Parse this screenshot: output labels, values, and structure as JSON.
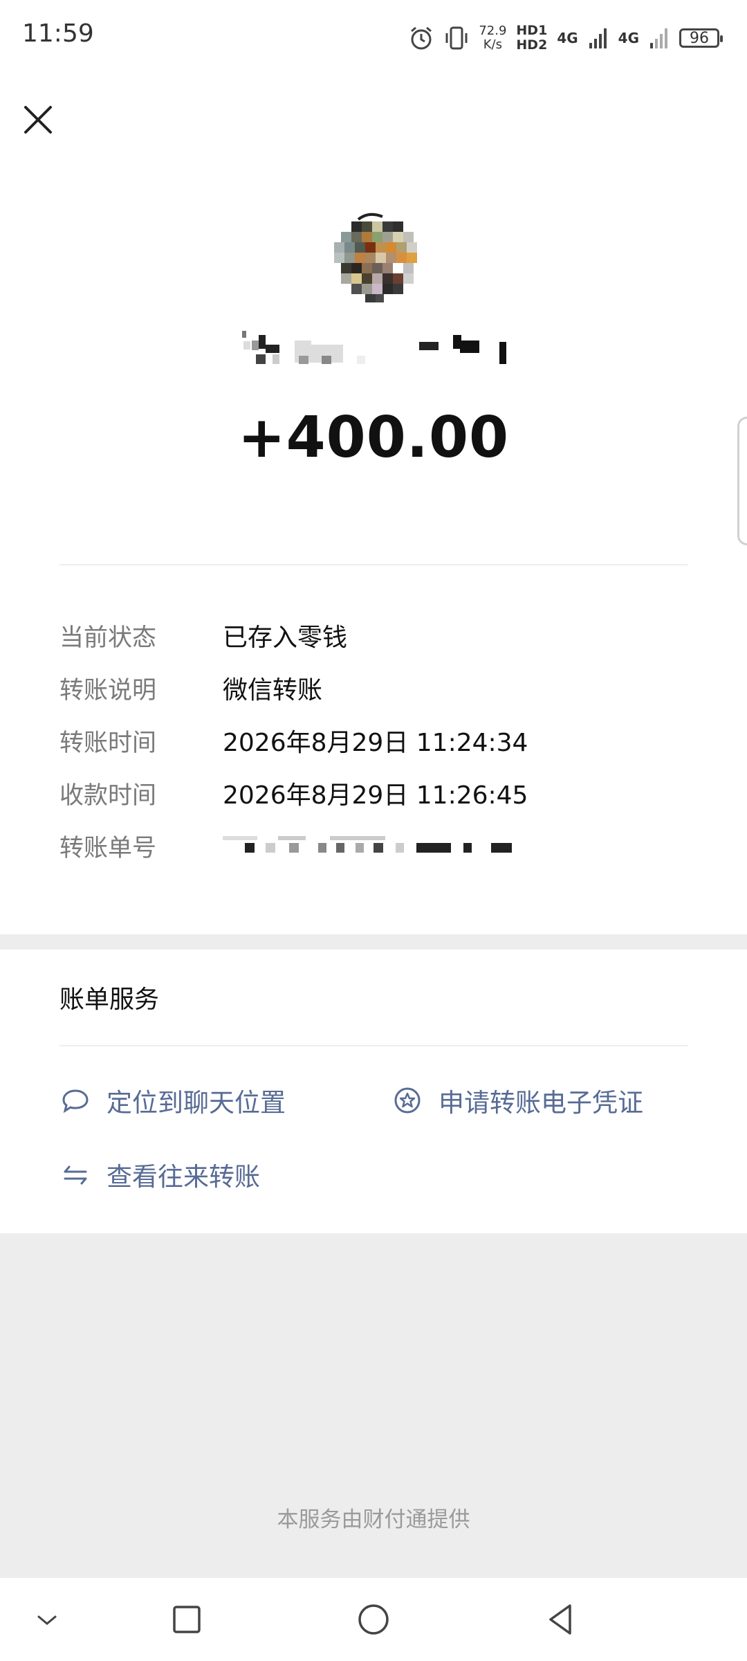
{
  "status_bar": {
    "time": "11:59",
    "net_speed_value": "72.9",
    "net_speed_unit": "K/s",
    "hd1": "HD1",
    "hd2": "HD2",
    "net1": "4G",
    "net2": "4G",
    "battery": "96",
    "icons": [
      "alarm-icon",
      "vibrate-icon",
      "signal-icon",
      "signal-icon"
    ]
  },
  "header": {
    "close_icon": "close-icon",
    "avatar_icon": "avatar-blurred",
    "amount": "+400.00"
  },
  "details": [
    {
      "label": "当前状态",
      "value": "已存入零钱"
    },
    {
      "label": "转账说明",
      "value": "微信转账"
    },
    {
      "label": "转账时间",
      "value": "2026年8月29日 11:24:34"
    },
    {
      "label": "收款时间",
      "value": "2026年8月29日 11:26:45"
    },
    {
      "label": "转账单号",
      "value": ""
    }
  ],
  "services": {
    "title": "账单服务",
    "items": [
      {
        "label": "定位到聊天位置",
        "icon": "chat-bubble-icon"
      },
      {
        "label": "申请转账电子凭证",
        "icon": "certificate-star-icon"
      },
      {
        "label": "查看往来转账",
        "icon": "exchange-arrows-icon"
      }
    ]
  },
  "footer": {
    "provider": "本服务由财付通提供"
  },
  "colors": {
    "link": "#576b95",
    "label_gray": "#7a7a7a",
    "background_gray": "#ededed"
  }
}
